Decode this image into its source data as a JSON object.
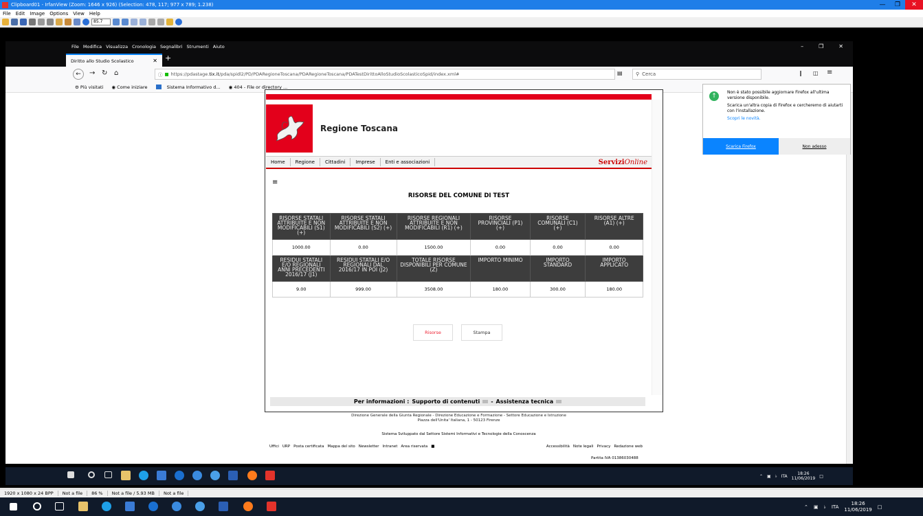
{
  "irfanview": {
    "title": "Clipboard01 - IrfanView (Zoom: 1646 x 926) (Selection: 478, 117; 977 x 789; 1.238)",
    "menu": [
      "File",
      "Edit",
      "Image",
      "Options",
      "View",
      "Help"
    ],
    "zoom_value": "85.7",
    "status": [
      "1920 x 1080 x 24 BPP",
      "Not a file",
      "86 %",
      "Not a file / 5.93 MB",
      "Not a file"
    ]
  },
  "firefox": {
    "menu": [
      "File",
      "Modifica",
      "Visualizza",
      "Cronologia",
      "Segnalibri",
      "Strumenti",
      "Aiuto"
    ],
    "tab_title": "Diritto allo Studio Scolastico",
    "url_prefix": "https://pdastage.",
    "url_host": "tix.it",
    "url_rest": "/pda/spidl2/PD/PDARegioneToscana/PDARegioneToscana/PDATestDirittoAlloStudioScolasticoSpid/index.xml#",
    "search_placeholder": "Cerca",
    "bookmarks": [
      "Più visitati",
      "Come iniziare",
      "Sistema Informativo d...",
      "404 - File or directory ..."
    ],
    "popup": {
      "line1": "Non è stato possibile aggiornare Firefox all'ultima versione disponibile.",
      "line2": "Scarica un'altra copia di Firefox e cercheremo di aiutarti con l'installazione.",
      "link": "Scopri le novità.",
      "download": "Scarica Firefox",
      "later": "Non adesso"
    }
  },
  "page": {
    "brand": "Regione Toscana",
    "nav": [
      "Home",
      "Regione",
      "Cittadini",
      "Imprese",
      "Enti e associazioni"
    ],
    "servizi_bold": "Servizi",
    "servizi_italic": "Online",
    "title": "RISORSE DEL COMUNE DI TEST",
    "table": {
      "headers1": [
        "RISORSE STATALI ATTRIBUITE E NON MODIFICABILI (S1) (+)",
        "RISORSE STATALI ATTRIBUITE E NON MODIFICABILI (S2) (+)",
        "RISORSE REGIONALI ATTRIBUITE E NON MODIFICABILI (R1) (+)",
        "RISORSE PROVINCIALI (P1) (+)",
        "RISORSE COMUNALI (C1) (+)",
        "RISORSE ALTRE (A1) (+)"
      ],
      "values1": [
        "1000.00",
        "0.00",
        "1500.00",
        "0.00",
        "0.00",
        "0.00"
      ],
      "headers2": [
        "RESIDUI STATALI E/O REGIONALI ANNI PRECEDENTI 2016/17 (J1)",
        "RESIDUI STATALI E/O REGIONALI DAL 2016/17 IN POI (J2)",
        "TOTALE RISORSE DISPONIBILI PER COMUNE (Z)",
        "IMPORTO MINIMO",
        "IMPORTO STANDARD",
        "IMPORTO APPLICATO"
      ],
      "values2": [
        "9.00",
        "999.00",
        "3508.00",
        "180.00",
        "300.00",
        "180.00"
      ]
    },
    "btn_risorse": "Risorse",
    "btn_stampa": "Stampa",
    "info_label": "Per informazioni :",
    "info_support": "Supporto di contenuti",
    "info_dash": "-",
    "info_tech": "Assistenza tecnica",
    "footer_line1": "Direzione Generale della Giunta Regionale - Direzione Educazione e Formazione - Settore Educazione e Istruzione",
    "footer_line2": "Piazza dell'Unita' Italiana, 1 - 50123 Firenze",
    "footer_line3": "Sistema Sviluppato dal Settore Sistemi Informativi e Tecnologie della Conoscenza",
    "links_left": [
      "Uffici",
      "URP",
      "Posta certificata",
      "Mappa del sito",
      "Newsletter",
      "Intranet",
      "Area riservata"
    ],
    "links_right": [
      "Accessibilità",
      "Note legali",
      "Privacy",
      "Redazione web"
    ],
    "piva": "Partita IVA 01386030488"
  },
  "tray": {
    "lang": "ITA",
    "time": "18:26",
    "date": "11/06/2019"
  }
}
